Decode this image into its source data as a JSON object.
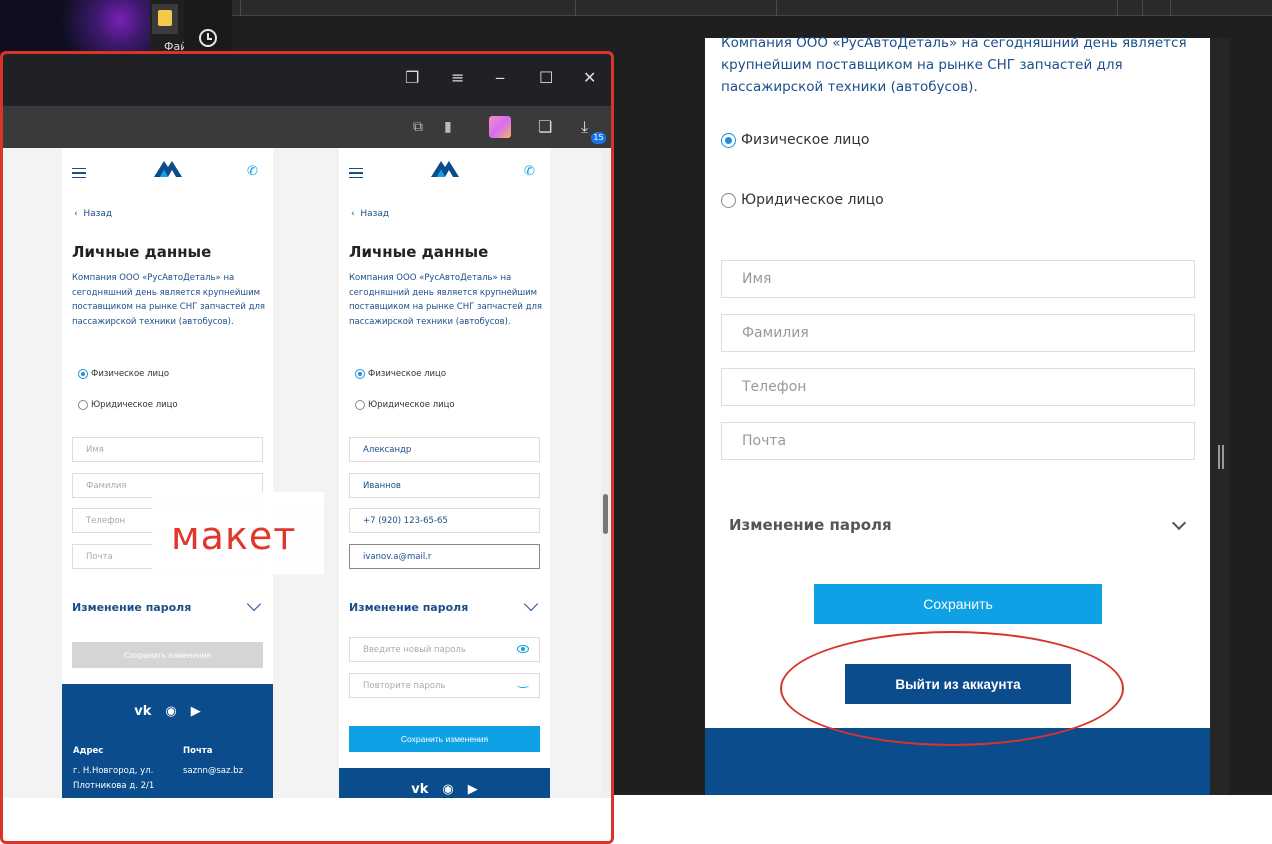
{
  "desktop": {
    "file_label": "Фай"
  },
  "browser": {
    "download_count": "15",
    "icons": [
      "tabs-icon",
      "menu-icon",
      "minimize-icon",
      "maximize-icon",
      "close-icon",
      "collections-icon",
      "bookmark-icon",
      "extension-icon",
      "download-icon"
    ]
  },
  "mockup_left": {
    "back": "Назад",
    "title": "Личные данные",
    "intro": "Компания ООО «РусАвтоДеталь» на сегодняшний день является крупнейшим поставщиком на рынке СНГ запчастей для пассажирской техники (автобусов).",
    "radio_individual": "Физическое лицо",
    "radio_legal": "Юридическое лицо",
    "fields": [
      "Имя",
      "Фамилия",
      "Телефон",
      "Почта"
    ],
    "password_section": "Изменение пароля",
    "save_button": "Сохранить изменения",
    "footer": {
      "address_heading": "Адрес",
      "address_text": "г. Н.Новгород, ул. Плотникова д. 2/1",
      "mail_heading": "Почта",
      "mail_text": "saznn@saz.bz",
      "social": [
        "vk",
        "whatsapp",
        "youtube"
      ]
    }
  },
  "mockup_right": {
    "back": "Назад",
    "title": "Личные данные",
    "intro": "Компания ООО «РусАвтоДеталь» на сегодняшний день является крупнейшим поставщиком на рынке СНГ запчастей для пассажирской техники (автобусов).",
    "radio_individual": "Физическое лицо",
    "radio_legal": "Юридическое лицо",
    "fields": [
      "Александр",
      "Иваннов",
      "+7 (920) 123-65-65",
      "ivanov.a@mail.r"
    ],
    "password_section": "Изменение пароля",
    "new_password_placeholder": "Введите новый пароль",
    "repeat_password_placeholder": "Повторите пароль",
    "save_button": "Сохранить изменения"
  },
  "annotation": {
    "label": "макет",
    "color": "#e02c20"
  },
  "site": {
    "intro": "Компания ООО «РусАвтоДеталь» на сегодняшний день является крупнейшим поставщиком на рынке СНГ запчастей для пассажирской техники (автобусов).",
    "radio_individual": "Физическое лицо",
    "radio_legal": "Юридическое лицо",
    "fields": [
      "Имя",
      "Фамилия",
      "Телефон",
      "Почта"
    ],
    "password_section": "Изменение пароля",
    "save_button": "Сохранить",
    "logout_button": "Выйти из аккаунта",
    "colors": {
      "accent": "#0ea1e6",
      "brand": "#0a4c8c"
    }
  }
}
